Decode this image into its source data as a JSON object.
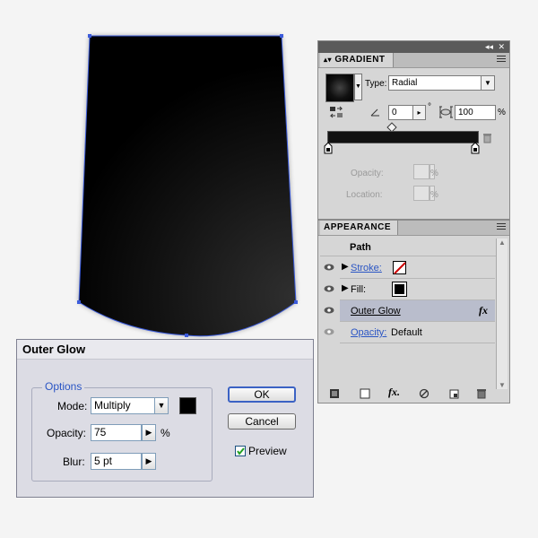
{
  "gradient_panel": {
    "tab": "GRADIENT",
    "type_label": "Type:",
    "type_value": "Radial",
    "angle_value": "0",
    "degree_symbol": "°",
    "aspect_value": "100",
    "percent_symbol": "%",
    "opacity_label": "Opacity:",
    "location_label": "Location:",
    "colors": {
      "ramp": "#111111"
    }
  },
  "appearance_panel": {
    "tab": "APPEARANCE",
    "header": "Path",
    "rows": [
      {
        "label": "Stroke:",
        "value": ""
      },
      {
        "label": "Fill:",
        "value": ""
      },
      {
        "label": "Outer Glow",
        "value": "fx"
      },
      {
        "label": "Opacity:",
        "value": "Default"
      }
    ],
    "footer_icons": [
      "new-art-basic-icon",
      "clear-appearance-icon",
      "add-effect-icon",
      "reduce-icon",
      "duplicate-item-icon",
      "delete-item-icon"
    ]
  },
  "outer_glow_dialog": {
    "title": "Outer Glow",
    "group_label": "Options",
    "mode_label": "Mode:",
    "mode_value": "Multiply",
    "opacity_label": "Opacity:",
    "opacity_value": "75",
    "opacity_unit": "%",
    "blur_label": "Blur:",
    "blur_value": "5 pt",
    "ok_label": "OK",
    "cancel_label": "Cancel",
    "preview_label": "Preview",
    "preview_checked": true,
    "glow_color": "#000000"
  }
}
